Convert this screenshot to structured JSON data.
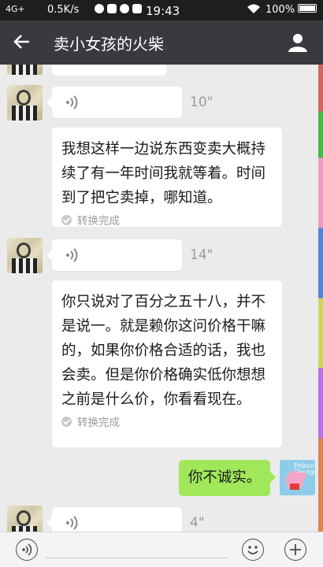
{
  "status_bar": {
    "network": "4G+",
    "speed": "0.5K/s",
    "time": "19:43",
    "battery": "100%"
  },
  "header": {
    "title": "卖小女孩的火柴"
  },
  "messages": {
    "voice_1": {
      "duration": "10\""
    },
    "text_1": {
      "text": "我想这样一边说东西变卖大概持续了有一年时间我就等着。时间到了把它卖掉，哪知道。",
      "status": "转换完成"
    },
    "voice_2": {
      "duration": "14\""
    },
    "text_2": {
      "text": "你只说对了百分之五十八，并不是说一。就是赖你这问价格干嘛的，如果你价格合适的话，我也会卖。但是你价格确实低你想想之前是什么价，你看看现在。",
      "status": "转换完成"
    },
    "sent_1": {
      "text": "你不诚实。"
    },
    "voice_3": {
      "duration": "4\""
    }
  },
  "my_avatar": {
    "brand": "Prince George"
  },
  "colors": {
    "sent_bubble": "#a0e75a",
    "title_bar": "#393a3f",
    "status_bar": "#1e1e1e"
  }
}
